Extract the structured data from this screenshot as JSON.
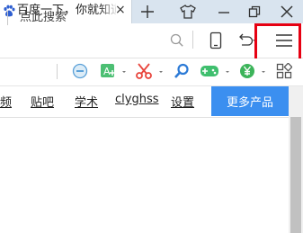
{
  "tab": {
    "title": "百度一下，你就知道",
    "close_glyph": "×"
  },
  "window": {
    "new_tab_glyph": "+",
    "minimize_glyph": "−",
    "close_glyph": "×"
  },
  "address_bar": {
    "placeholder": "点此搜索"
  },
  "links": [
    "频",
    "贴吧",
    "学术",
    "clyghss",
    "设置"
  ],
  "more_products_label": "更多产品",
  "colors": {
    "highlight": "#e60012",
    "more_button": "#3b8ff0",
    "tabstrip": "#d9e4ef"
  }
}
